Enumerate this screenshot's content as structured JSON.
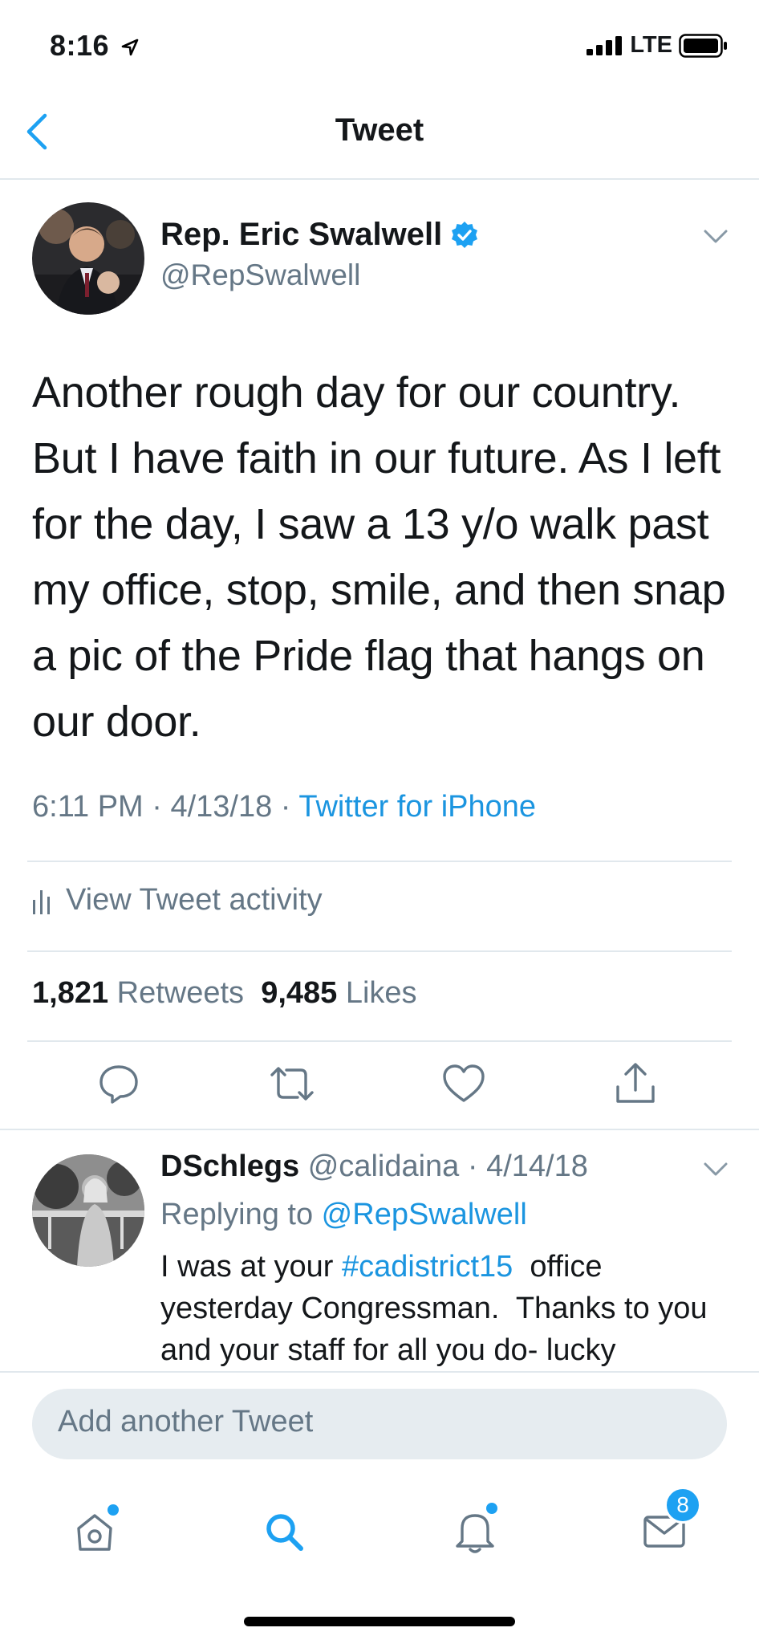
{
  "status_bar": {
    "time": "8:16",
    "carrier": "LTE"
  },
  "nav": {
    "title": "Tweet"
  },
  "tweet": {
    "author_name": "Rep. Eric Swalwell",
    "author_handle": "@RepSwalwell",
    "text": "Another rough day for our country. But I have faith in our future. As I left for the day, I saw a 13 y/o walk past my office, stop, smile, and then snap a pic of the Pride flag that hangs on our door.",
    "timestamp": "6:11 PM · 4/13/18 · ",
    "source": "Twitter for iPhone",
    "activity_label": "View Tweet activity",
    "retweets_count": "1,821",
    "retweets_label": "Retweets",
    "likes_count": "9,485",
    "likes_label": "Likes"
  },
  "reply": {
    "author_name": "DSchlegs",
    "author_handle": "@calidaina",
    "date": "· 4/14/18",
    "replying_to_prefix": "Replying to ",
    "replying_to_handle": "@RepSwalwell",
    "text_before": "I was at your ",
    "hashtag": "#cadistrict15",
    "text_after": "  office yesterday Congressman.  Thanks to you and your staff for all you do- lucky"
  },
  "compose": {
    "placeholder": "Add another Tweet"
  },
  "tab_bar": {
    "messages_badge": "8"
  },
  "colors": {
    "accent": "#1b95e0",
    "muted": "#657786",
    "divider": "#e1e8ed"
  },
  "icons": [
    "location-arrow-icon",
    "signal-icon",
    "battery-icon",
    "back-chevron-icon",
    "verified-badge-icon",
    "chevron-down-icon",
    "bar-chart-icon",
    "reply-icon",
    "retweet-icon",
    "like-icon",
    "share-icon",
    "home-icon",
    "search-icon",
    "notifications-icon",
    "messages-icon"
  ]
}
